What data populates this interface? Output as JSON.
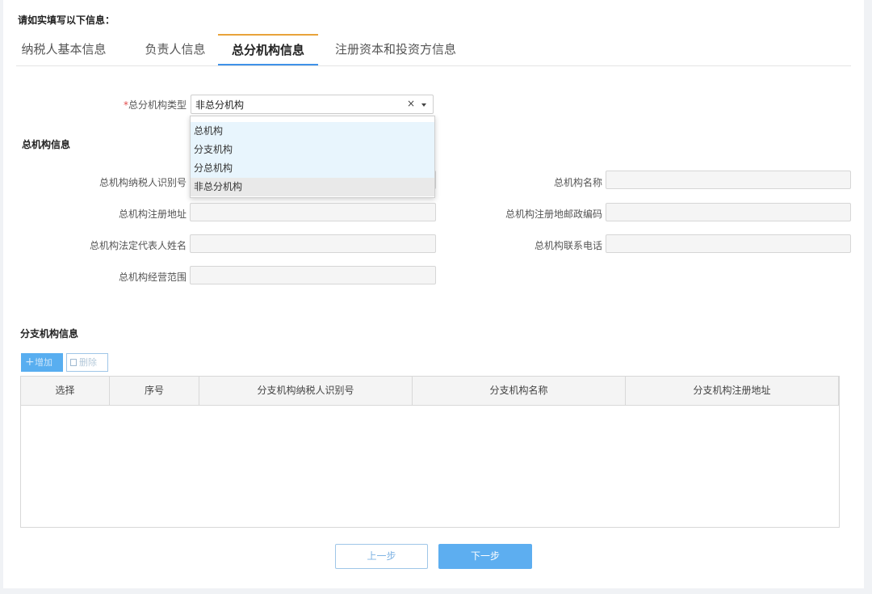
{
  "intro": "请如实填写以下信息：",
  "tabs": [
    {
      "label": "纳税人基本信息"
    },
    {
      "label": "负责人信息"
    },
    {
      "label": "总分机构信息"
    },
    {
      "label": "注册资本和投资方信息"
    }
  ],
  "branch_type": {
    "required_mark": "*",
    "label": "总分机构类型",
    "value": "非总分机构",
    "clear": "×",
    "options": [
      "总机构",
      "分支机构",
      "分总机构",
      "非总分机构"
    ]
  },
  "hq_section": {
    "title": "总机构信息",
    "fields": {
      "tax_id": "总机构纳税人识别号",
      "name": "总机构名称",
      "reg_address": "总机构注册地址",
      "reg_postcode": "总机构注册地邮政编码",
      "legal_rep": "总机构法定代表人姓名",
      "phone": "总机构联系电话",
      "scope": "总机构经营范围"
    }
  },
  "branch_section": {
    "title": "分支机构信息",
    "add_label": "增加",
    "delete_label": "删除",
    "columns": [
      "选择",
      "序号",
      "分支机构纳税人识别号",
      "分支机构名称",
      "分支机构注册地址"
    ]
  },
  "footer": {
    "prev_label": "上一步",
    "next_label": "下一步"
  }
}
